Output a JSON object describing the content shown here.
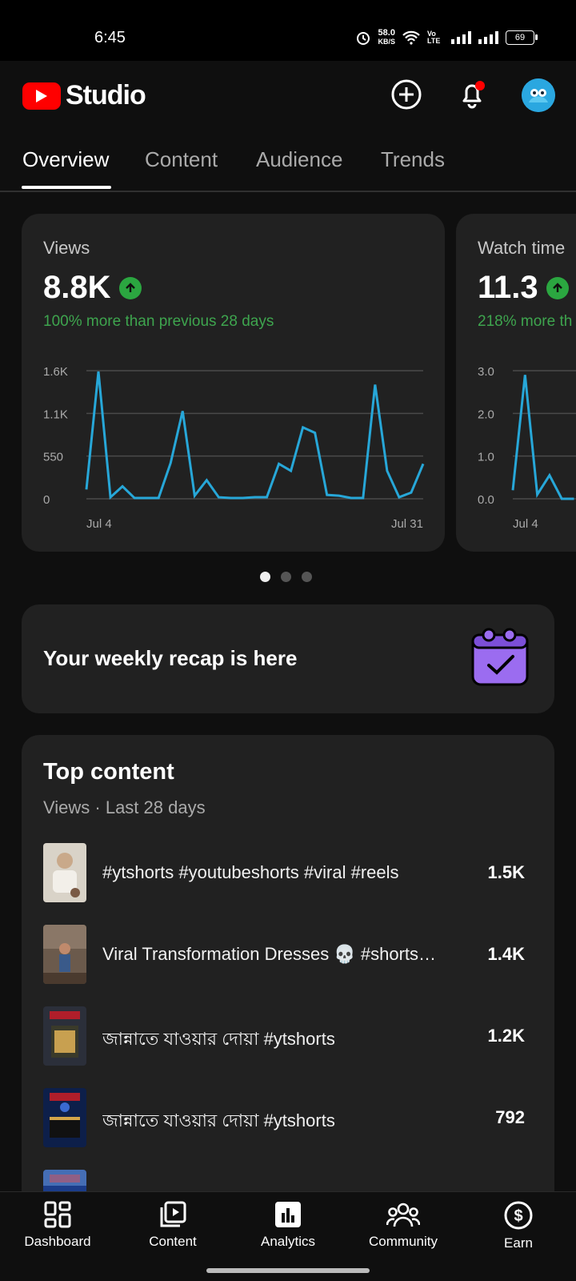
{
  "status_bar": {
    "time": "6:45",
    "net_speed": "58.0",
    "net_unit": "KB/S",
    "volte": "Vo LTE",
    "battery": "69"
  },
  "app": {
    "name": "Studio",
    "brand_color": "#ff0000"
  },
  "tabs": [
    {
      "label": "Overview",
      "active": true
    },
    {
      "label": "Content",
      "active": false
    },
    {
      "label": "Audience",
      "active": false
    },
    {
      "label": "Trends",
      "active": false
    }
  ],
  "metrics": [
    {
      "label": "Views",
      "value": "8.8K",
      "trend": "up",
      "compare": "100% more than previous 28 days",
      "chart_data": {
        "type": "line",
        "y_ticks": [
          "1.6K",
          "1.1K",
          "550",
          "0"
        ],
        "ylim": [
          0,
          1650
        ],
        "x_labels": [
          "Jul 4",
          "Jul 31"
        ],
        "x": [
          "Jul 4",
          "Jul 5",
          "Jul 6",
          "Jul 7",
          "Jul 8",
          "Jul 9",
          "Jul 10",
          "Jul 11",
          "Jul 12",
          "Jul 13",
          "Jul 14",
          "Jul 15",
          "Jul 16",
          "Jul 17",
          "Jul 18",
          "Jul 19",
          "Jul 20",
          "Jul 21",
          "Jul 22",
          "Jul 23",
          "Jul 24",
          "Jul 25",
          "Jul 26",
          "Jul 27",
          "Jul 28",
          "Jul 29",
          "Jul 30",
          "Jul 31"
        ],
        "values": [
          120,
          1640,
          20,
          160,
          10,
          10,
          10,
          460,
          1130,
          40,
          240,
          20,
          10,
          10,
          20,
          20,
          450,
          360,
          920,
          850,
          50,
          40,
          10,
          10,
          1470,
          360,
          20,
          80,
          450
        ],
        "color": "#27a7d8"
      }
    },
    {
      "label": "Watch time",
      "value": "11.3",
      "trend": "up",
      "compare": "218% more th",
      "chart_data": {
        "type": "line",
        "y_ticks": [
          "3.0",
          "2.0",
          "1.0",
          "0.0"
        ],
        "ylim": [
          0,
          3.0
        ],
        "x_labels": [
          "Jul 4"
        ],
        "values": [
          0.2,
          2.9,
          0.1,
          0.55,
          0.0,
          0.0
        ],
        "color": "#27a7d8"
      }
    }
  ],
  "carousel": {
    "pages": 3,
    "active": 0
  },
  "recap": {
    "text": "Your weekly recap is here"
  },
  "top_content": {
    "title": "Top content",
    "subtitle": "Views · Last 28 days",
    "items": [
      {
        "title": "#ytshorts #youtubeshorts #viral #reels",
        "views": "1.5K"
      },
      {
        "title": "Viral Transformation Dresses 💀 #shorts…",
        "views": "1.4K"
      },
      {
        "title": "জান্নাতে যাওয়ার দোয়া #ytshorts",
        "views": "1.2K"
      },
      {
        "title": "জান্নাতে যাওয়ার দোয়া  #ytshorts",
        "views": "792"
      }
    ]
  },
  "bottom_nav": [
    {
      "label": "Dashboard",
      "icon": "dashboard-icon"
    },
    {
      "label": "Content",
      "icon": "content-icon"
    },
    {
      "label": "Analytics",
      "icon": "analytics-icon",
      "active": true
    },
    {
      "label": "Community",
      "icon": "community-icon"
    },
    {
      "label": "Earn",
      "icon": "earn-icon"
    }
  ]
}
